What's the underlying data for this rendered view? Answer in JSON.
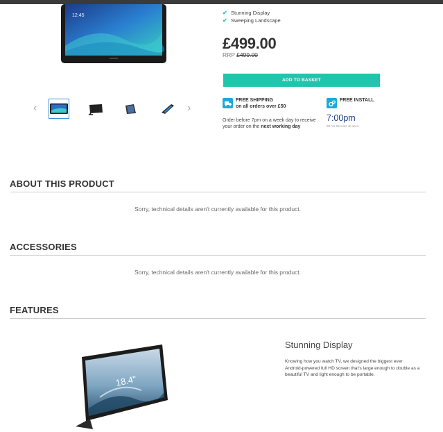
{
  "product": {
    "features": [
      "Stunning Display",
      "Sweeping Landscape"
    ],
    "price": "£499.00",
    "rrp_label": "RRP",
    "rrp_value": "£499.00",
    "screen_time": "12:45",
    "add_button": "ADD TO BASKET"
  },
  "shipping": {
    "title": "FREE SHIPPING",
    "subtitle": "on all orders over £50",
    "note_prefix": "Order before 7pm on a week day to receive your order on the",
    "note_bold": "next working day"
  },
  "install": {
    "title": "FREE INSTALL",
    "time": "7:00pm",
    "countdown": "08 hrs 04 mins 40 secs"
  },
  "gallery": {
    "prev": "‹",
    "next": "›",
    "thumbnails": [
      "thumbnail-1",
      "thumbnail-2",
      "thumbnail-3",
      "thumbnail-4"
    ]
  },
  "sections": {
    "about": {
      "title": "ABOUT THIS PRODUCT",
      "notice": "Sorry, technical details aren't currently available for this product."
    },
    "accessories": {
      "title": "ACCESSORIES",
      "notice": "Sorry, technical details aren't currently available for this product."
    },
    "features": {
      "title": "FEATURES"
    }
  },
  "feature_block": {
    "heading": "Stunning Display",
    "body": "Knowing how you watch TV, we designed the biggest ever Android-powered full HD screen that's large enough to double as a beautiful TV and light enough to be portable.",
    "screen_label": "18.4\""
  },
  "colors": {
    "accent": "#21c4ad",
    "icon_bg": "#21a9d6",
    "time": "#1b3a8a"
  }
}
